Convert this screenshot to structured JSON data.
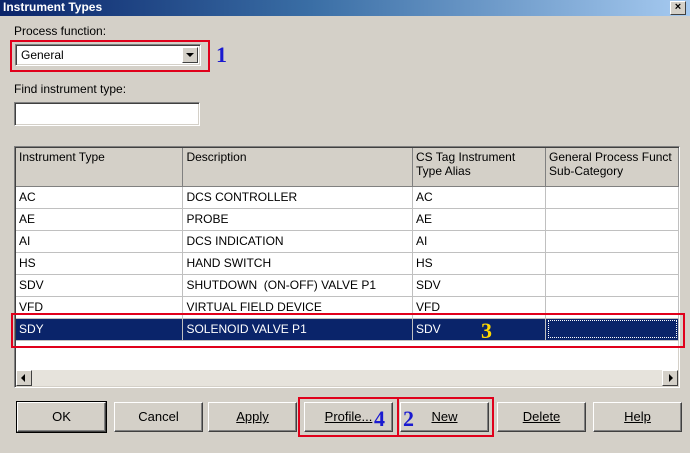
{
  "window": {
    "title": "Instrument Types",
    "close_glyph": "×"
  },
  "process_function": {
    "label": "Process function:",
    "selected": "General"
  },
  "find": {
    "label": "Find instrument type:",
    "value": ""
  },
  "grid": {
    "columns": [
      "Instrument Type",
      "Description",
      "CS Tag Instrument Type Alias",
      "General Process Funct Sub-Category"
    ],
    "rows": [
      [
        "AC",
        "DCS CONTROLLER",
        "AC",
        ""
      ],
      [
        "AE",
        "PROBE",
        "AE",
        ""
      ],
      [
        "AI",
        "DCS INDICATION",
        "AI",
        ""
      ],
      [
        "HS",
        "HAND SWITCH",
        "HS",
        ""
      ],
      [
        "SDV",
        "SHUTDOWN  (ON-OFF) VALVE P1",
        "SDV",
        ""
      ],
      [
        "VFD",
        "VIRTUAL FIELD DEVICE",
        "VFD",
        ""
      ],
      [
        "SDY",
        "SOLENOID VALVE P1",
        "SDV",
        ""
      ]
    ],
    "selected_row": 6
  },
  "buttons": {
    "ok": "OK",
    "cancel": "Cancel",
    "apply": "Apply",
    "profile": "Profile...",
    "new": "New",
    "delete": "Delete",
    "help": "Help"
  },
  "annotations": {
    "n1": "1",
    "n2": "2",
    "n3": "3",
    "n4": "4"
  },
  "colors": {
    "annotation_red": "#e0001b",
    "number_blue": "#1a1ad0",
    "number_yellow": "#ffd800",
    "selection": "#0a246a"
  }
}
